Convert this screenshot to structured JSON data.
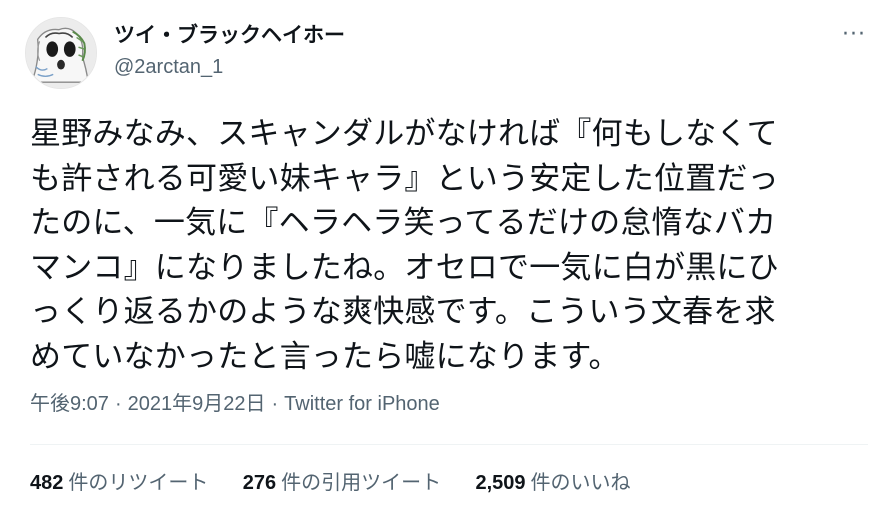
{
  "user": {
    "display_name": "ツイ・ブラックヘイホー",
    "handle": "@2arctan_1"
  },
  "more_icon_text": "···",
  "tweet_text": "星野みなみ、スキャンダルがなければ『何もしなくて\nも許される可愛い妹キャラ』という安定した位置だっ\nたのに、一気に『ヘラヘラ笑ってるだけの怠惰なバカ\nマンコ』になりましたね。オセロで一気に白が黒にひ\nっくり返るかのような爽快感です。こういう文春を求\nめていなかったと言ったら嘘になります。",
  "meta": {
    "time": "午後9:07",
    "separator": "·",
    "date": "2021年9月22日",
    "source": "Twitter for iPhone"
  },
  "stats": {
    "retweets_count": "482",
    "retweets_label": "件のリツイート",
    "quotes_count": "276",
    "quotes_label": "件の引用ツイート",
    "likes_count": "2,509",
    "likes_label": "件のいいね"
  },
  "colors": {
    "text": "#0f1419",
    "secondary": "#536471",
    "divider": "#eff3f4"
  }
}
